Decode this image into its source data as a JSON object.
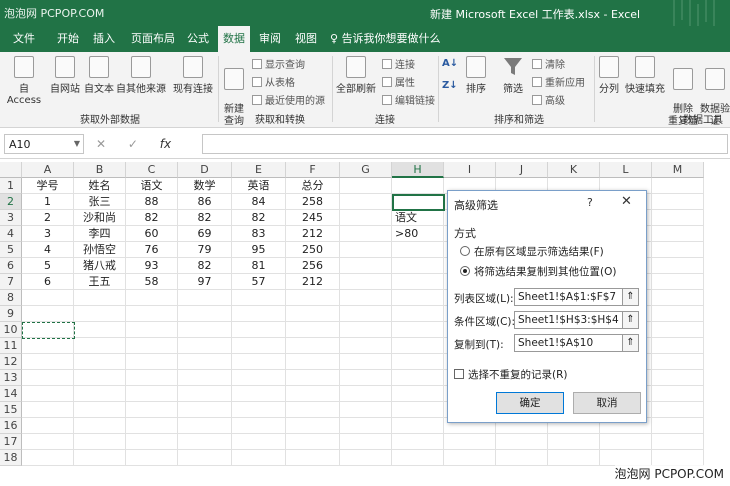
{
  "watermark": "泡泡网 PCPOP.COM",
  "window_title": "新建 Microsoft Excel 工作表.xlsx  -  Excel",
  "tabs": [
    "文件",
    "开始",
    "插入",
    "页面布局",
    "公式",
    "数据",
    "审阅",
    "视图"
  ],
  "tellme": "告诉我你想要做什么",
  "ribbon": {
    "get_external": {
      "buttons": [
        "自 Access",
        "自网站",
        "自文本",
        "自其他来源",
        "现有连接"
      ],
      "label": "获取外部数据"
    },
    "get_transform": {
      "new_query": "新建\n查询",
      "small": [
        "显示查询",
        "从表格",
        "最近使用的源"
      ],
      "label": "获取和转换"
    },
    "connections": {
      "refresh": "全部刷新",
      "small": [
        "连接",
        "属性",
        "编辑链接"
      ],
      "label": "连接"
    },
    "sort_filter": {
      "sort": "排序",
      "filter": "筛选",
      "small": [
        "清除",
        "重新应用",
        "高级"
      ],
      "label": "排序和筛选"
    },
    "data_tools": {
      "buttons": [
        "分列",
        "快速填充",
        "删除\n重复值",
        "数据验\n证"
      ],
      "label": "数据工具"
    }
  },
  "name_box": "A10",
  "formula_icons": [
    "✕",
    "✓",
    "fx"
  ],
  "columns": [
    "A",
    "B",
    "C",
    "D",
    "E",
    "F",
    "G",
    "H",
    "I",
    "J",
    "K",
    "L",
    "M"
  ],
  "rows": [
    "1",
    "2",
    "3",
    "4",
    "5",
    "6",
    "7",
    "8",
    "9",
    "10",
    "11",
    "12",
    "13",
    "14",
    "15",
    "16",
    "17",
    "18"
  ],
  "table": {
    "headers": [
      "学号",
      "姓名",
      "语文",
      "数学",
      "英语",
      "总分"
    ],
    "rows": [
      [
        "1",
        "张三",
        "88",
        "86",
        "84",
        "258"
      ],
      [
        "2",
        "沙和尚",
        "82",
        "82",
        "82",
        "245"
      ],
      [
        "3",
        "李四",
        "60",
        "69",
        "83",
        "212"
      ],
      [
        "4",
        "孙悟空",
        "76",
        "79",
        "95",
        "250"
      ],
      [
        "5",
        "猪八戒",
        "93",
        "82",
        "81",
        "256"
      ],
      [
        "6",
        "王五",
        "58",
        "97",
        "57",
        "212"
      ]
    ]
  },
  "criteria": {
    "h3": "语文",
    "h4": ">80"
  },
  "dialog": {
    "title": "高级筛选",
    "help": "?",
    "close": "✕",
    "section": "方式",
    "option1": "在原有区域显示筛选结果(F)",
    "option2": "将筛选结果复制到其他位置(O)",
    "list_label": "列表区域(L):",
    "list_value": "Sheet1!$A$1:$F$7",
    "criteria_label": "条件区域(C):",
    "criteria_value": "Sheet1!$H$3:$H$4",
    "copy_label": "复制到(T):",
    "copy_value": "Sheet1!$A$10",
    "unique_label": "选择不重复的记录(R)",
    "ok": "确定",
    "cancel": "取消"
  },
  "footer_watermark": "泡泡网  PCPOP.COM"
}
